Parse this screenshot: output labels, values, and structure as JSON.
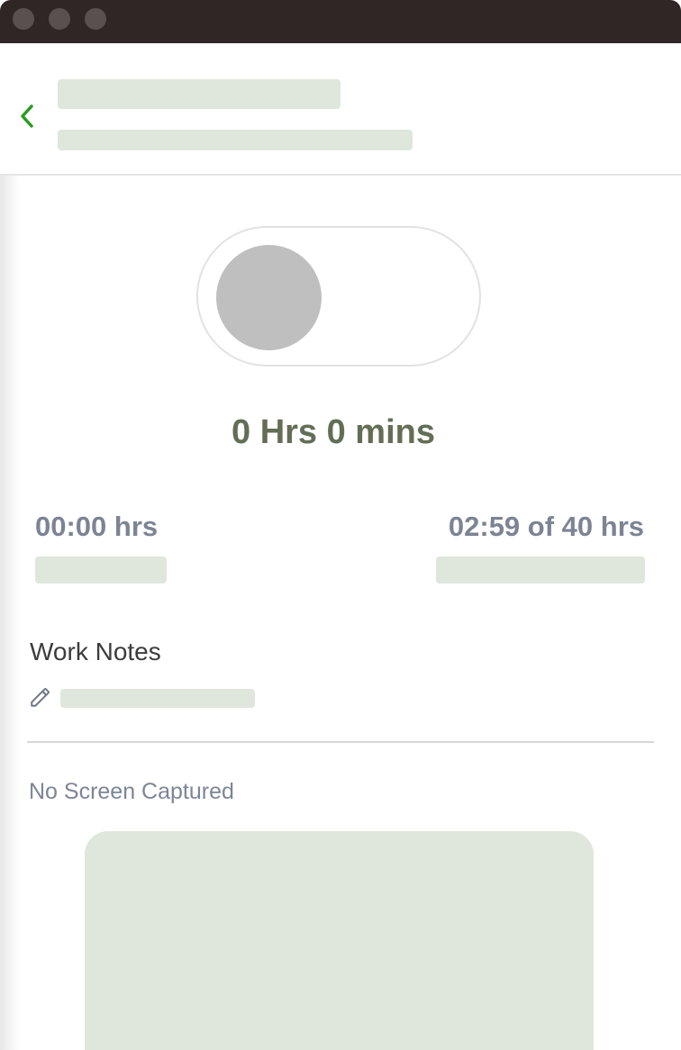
{
  "toggle": {
    "state": "off"
  },
  "summary": {
    "total_time": "0 Hrs 0 mins",
    "today_hours": "00:00 hrs",
    "weekly_hours": "02:59 of 40 hrs"
  },
  "notes": {
    "label": "Work Notes",
    "edit_icon": "pencil-icon"
  },
  "screenshots": {
    "empty_text": "No Screen Captured"
  },
  "icons": {
    "back": "chevron-left-icon"
  },
  "colors": {
    "accent_green": "#2a9d1f",
    "time_text": "#636e55",
    "stat_text": "#7c8494",
    "skeleton": "#dfe6dc",
    "titlebar": "#302626"
  }
}
